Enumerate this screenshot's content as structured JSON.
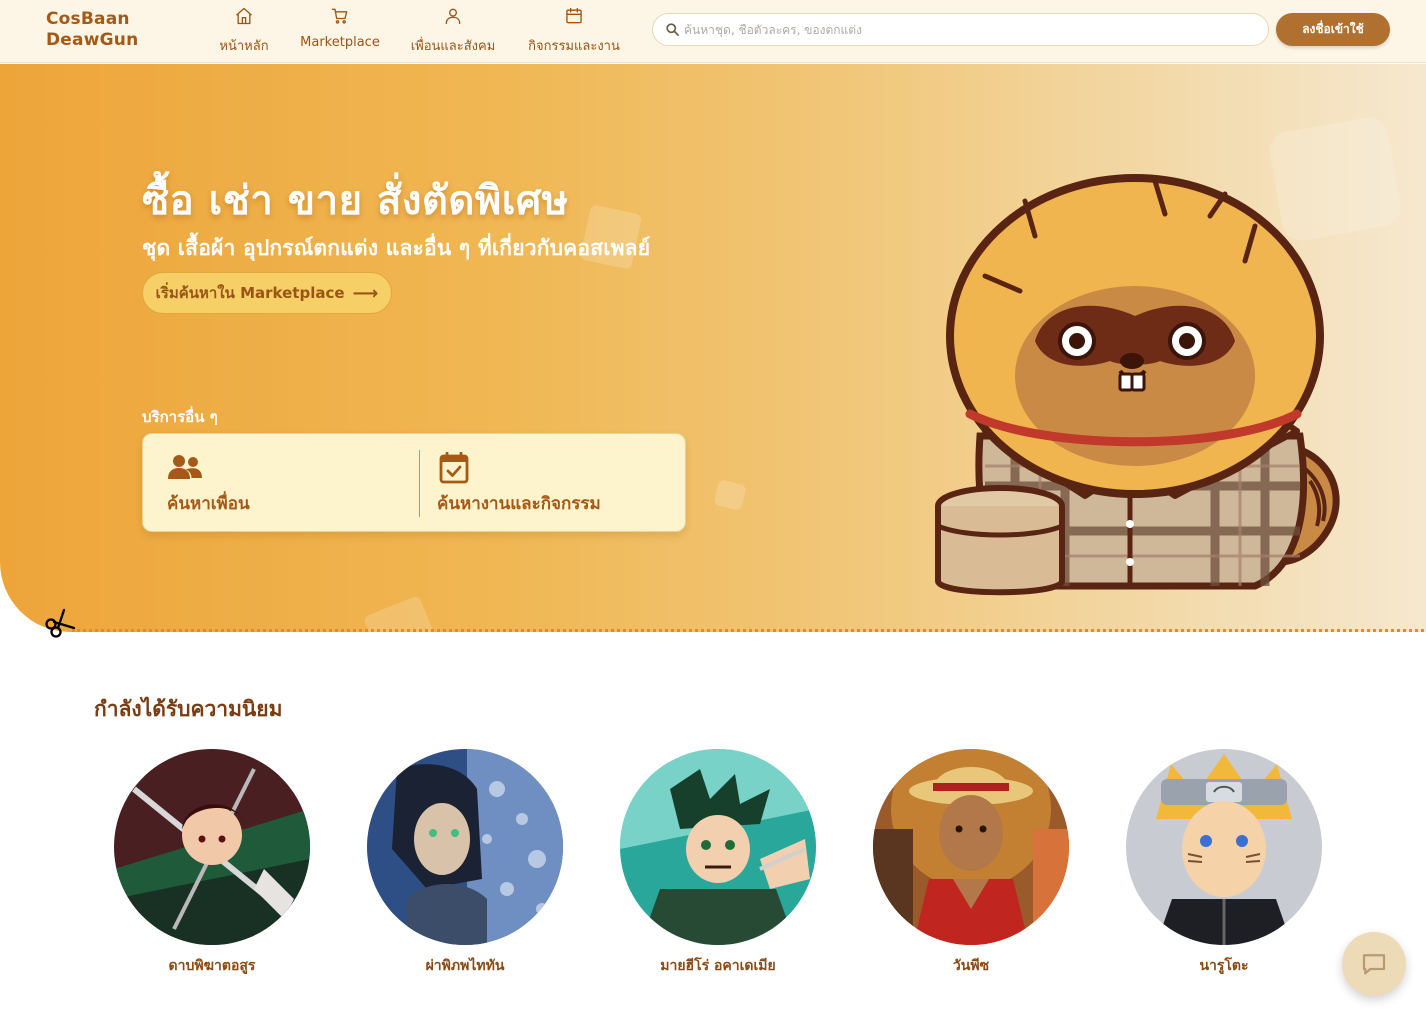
{
  "brand": {
    "line1": "CosBaan",
    "line2": "DeawGun"
  },
  "nav": {
    "items": [
      {
        "label": "หน้าหลัก",
        "icon": "home-icon"
      },
      {
        "label": "Marketplace",
        "icon": "cart-icon"
      },
      {
        "label": "เพื่อนและสังคม",
        "icon": "user-icon"
      },
      {
        "label": "กิจกรรมและงาน",
        "icon": "calendar-icon"
      }
    ],
    "search_placeholder": "ค้นหาชุด, ชื่อตัวละคร, ของตกแต่ง",
    "signup_label": "ลงชื่อเข้าใช้"
  },
  "hero": {
    "title": "ซื้อ เช่า ขาย สั่งตัดพิเศษ",
    "subtitle": "ชุด เสื้อผ้า อุปกรณ์ตกแต่ง และอื่น ๆ ที่เกี่ยวกับคอสเพลย์",
    "cta_label": "เริ่มค้นหาใน Marketplace",
    "cta_arrow": "⟶",
    "other_services_label": "บริการอื่น ๆ",
    "services": [
      {
        "label": "ค้นหาเพื่อน",
        "icon": "users-icon"
      },
      {
        "label": "ค้นหางานและกิจกรรม",
        "icon": "calendar-check-icon"
      }
    ]
  },
  "popular": {
    "title": "กำลังได้รับความนิยม",
    "items": [
      {
        "name": "ดาบพิฆาตอสูร"
      },
      {
        "name": "ผ่าพิภพไททัน"
      },
      {
        "name": "มายฮีโร่ อคาเดเมีย"
      },
      {
        "name": "วันพีซ"
      },
      {
        "name": "นารูโตะ"
      }
    ]
  },
  "colors": {
    "accent": "#b0702f",
    "brand_text": "#a45a16",
    "hero_orange": "#eda53a",
    "nav_bg": "#fdf6e6"
  }
}
